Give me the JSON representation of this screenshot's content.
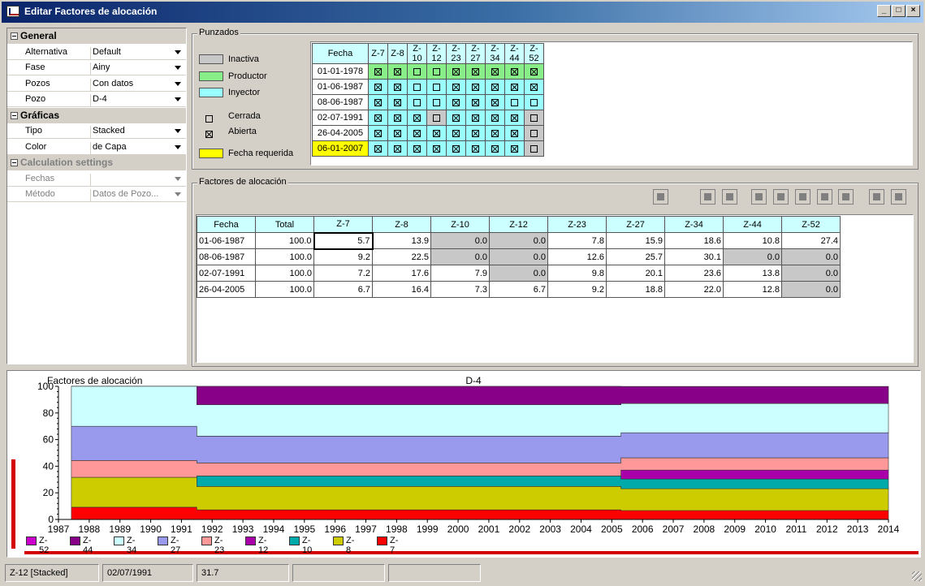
{
  "window": {
    "title": "Editar Factores de alocación",
    "minimize": "_",
    "maximize": "□",
    "close": "×"
  },
  "properties": [
    {
      "kind": "category",
      "label": "General"
    },
    {
      "kind": "item",
      "label": "Alternativa",
      "value": "Default"
    },
    {
      "kind": "item",
      "label": "Fase",
      "value": "Ainy"
    },
    {
      "kind": "item",
      "label": "Pozos",
      "value": "Con datos"
    },
    {
      "kind": "item",
      "label": "Pozo",
      "value": "D-4"
    },
    {
      "kind": "category",
      "label": "Gráficas"
    },
    {
      "kind": "item",
      "label": "Tipo",
      "value": "Stacked"
    },
    {
      "kind": "item",
      "label": "Color",
      "value": "de Capa"
    },
    {
      "kind": "category",
      "label": "Calculation settings",
      "disabled": true
    },
    {
      "kind": "item",
      "label": "Fechas",
      "value": "",
      "disabled": true
    },
    {
      "kind": "item",
      "label": "Método",
      "value": "Datos de Pozo...",
      "disabled": true
    }
  ],
  "punzados": {
    "title": "Punzados",
    "legend": {
      "inactiva": "Inactiva",
      "productor": "Productor",
      "inyector": "Inyector",
      "cerrada": "Cerrada",
      "abierta": "Abierta",
      "fecha_requerida": "Fecha requerida"
    },
    "colors": {
      "inactiva": "#c8c8c8",
      "productor": "#88ee88",
      "inyector": "#99ffff",
      "fecha_requerida": "#ffff00"
    },
    "headers": [
      "Fecha",
      "Z-7",
      "Z-8",
      "Z-10",
      "Z-12",
      "Z-23",
      "Z-27",
      "Z-34",
      "Z-44",
      "Z-52"
    ],
    "rows": [
      {
        "date": "01-01-1978",
        "kind": "productor",
        "cells": [
          1,
          1,
          0,
          0,
          1,
          1,
          1,
          1,
          1
        ],
        "cell_kinds": [
          "p",
          "p",
          "p",
          "p",
          "p",
          "p",
          "p",
          "p",
          "p"
        ]
      },
      {
        "date": "01-06-1987",
        "kind": "inyector",
        "cells": [
          1,
          1,
          0,
          0,
          1,
          1,
          1,
          1,
          1
        ],
        "cell_kinds": [
          "i",
          "i",
          "i",
          "i",
          "i",
          "i",
          "i",
          "i",
          "i"
        ]
      },
      {
        "date": "08-06-1987",
        "kind": "inyector",
        "cells": [
          1,
          1,
          0,
          0,
          1,
          1,
          1,
          0,
          0
        ],
        "cell_kinds": [
          "i",
          "i",
          "i",
          "i",
          "i",
          "i",
          "i",
          "i",
          "i"
        ]
      },
      {
        "date": "02-07-1991",
        "kind": "inyector",
        "cells": [
          1,
          1,
          1,
          0,
          1,
          1,
          1,
          1,
          0
        ],
        "cell_kinds": [
          "i",
          "i",
          "i",
          "x",
          "i",
          "i",
          "i",
          "i",
          "x"
        ]
      },
      {
        "date": "26-04-2005",
        "kind": "inyector",
        "cells": [
          1,
          1,
          1,
          1,
          1,
          1,
          1,
          1,
          0
        ],
        "cell_kinds": [
          "i",
          "i",
          "i",
          "i",
          "i",
          "i",
          "i",
          "i",
          "x"
        ]
      },
      {
        "date": "06-01-2007",
        "kind": "requerida",
        "cells": [
          1,
          1,
          1,
          1,
          1,
          1,
          1,
          1,
          0
        ],
        "cell_kinds": [
          "i",
          "i",
          "i",
          "i",
          "i",
          "i",
          "i",
          "i",
          "x"
        ]
      }
    ]
  },
  "factores": {
    "title": "Factores de alocación",
    "headers": [
      "Fecha",
      "Total",
      "Z-7",
      "Z-8",
      "Z-10",
      "Z-12",
      "Z-23",
      "Z-27",
      "Z-34",
      "Z-44",
      "Z-52"
    ],
    "rows": [
      [
        "01-06-1987",
        "100.0",
        "5.7",
        "13.9",
        "0.0",
        "0.0",
        "7.8",
        "15.9",
        "18.6",
        "10.8",
        "27.4"
      ],
      [
        "08-06-1987",
        "100.0",
        "9.2",
        "22.5",
        "0.0",
        "0.0",
        "12.6",
        "25.7",
        "30.1",
        "0.0",
        "0.0"
      ],
      [
        "02-07-1991",
        "100.0",
        "7.2",
        "17.6",
        "7.9",
        "0.0",
        "9.8",
        "20.1",
        "23.6",
        "13.8",
        "0.0"
      ],
      [
        "26-04-2005",
        "100.0",
        "6.7",
        "16.4",
        "7.3",
        "6.7",
        "9.2",
        "18.8",
        "22.0",
        "12.8",
        "0.0"
      ]
    ],
    "toolbar_icons": [
      "properties-icon",
      "page-icon",
      "minus-page-icon",
      "add-row-icon",
      "insert-left-icon",
      "insert-right-icon",
      "undo-icon",
      "save-icon",
      "sort-az-icon",
      "camera-icon"
    ]
  },
  "chart_data": {
    "type": "area",
    "title": "D-4",
    "subtitle_left": "Factores de alocación",
    "stacked": true,
    "xlim": [
      1987,
      2014
    ],
    "ylim": [
      0,
      100
    ],
    "yticks": [
      "0",
      "20",
      "40",
      "60",
      "80",
      "100"
    ],
    "xticks": [
      "1987",
      "1988",
      "1989",
      "1990",
      "1991",
      "1992",
      "1993",
      "1994",
      "1995",
      "1996",
      "1997",
      "1998",
      "1999",
      "2000",
      "2001",
      "2002",
      "2003",
      "2004",
      "2005",
      "2006",
      "2007",
      "2008",
      "2009",
      "2010",
      "2011",
      "2012",
      "2013",
      "2014"
    ],
    "breakpoints": [
      1987.42,
      1991.5,
      2005.3,
      2014
    ],
    "series": [
      {
        "name": "Z-7",
        "color": "#ff0000",
        "values": [
          9.2,
          7.2,
          6.7
        ]
      },
      {
        "name": "Z-8",
        "color": "#cccc00",
        "values": [
          22.5,
          17.6,
          16.4
        ]
      },
      {
        "name": "Z-10",
        "color": "#00aaaa",
        "values": [
          0.0,
          7.9,
          7.3
        ]
      },
      {
        "name": "Z-12",
        "color": "#aa00aa",
        "values": [
          0.0,
          0.0,
          6.7
        ]
      },
      {
        "name": "Z-23",
        "color": "#ff9999",
        "values": [
          12.6,
          9.8,
          9.2
        ]
      },
      {
        "name": "Z-27",
        "color": "#9999ee",
        "values": [
          25.7,
          20.1,
          18.8
        ]
      },
      {
        "name": "Z-34",
        "color": "#ccffff",
        "values": [
          30.1,
          23.6,
          22.0
        ]
      },
      {
        "name": "Z-44",
        "color": "#880088",
        "values": [
          0.0,
          13.8,
          12.8
        ]
      },
      {
        "name": "Z-52",
        "color": "#cc00cc",
        "values": [
          0.0,
          0.0,
          0.0
        ]
      }
    ],
    "legend_order": [
      "Z-52",
      "Z-44",
      "Z-34",
      "Z-27",
      "Z-23",
      "Z-12",
      "Z-10",
      "Z-8",
      "Z-7"
    ]
  },
  "status": [
    "Z-12 [Stacked]",
    "02/07/1991",
    "31.7",
    "",
    ""
  ]
}
